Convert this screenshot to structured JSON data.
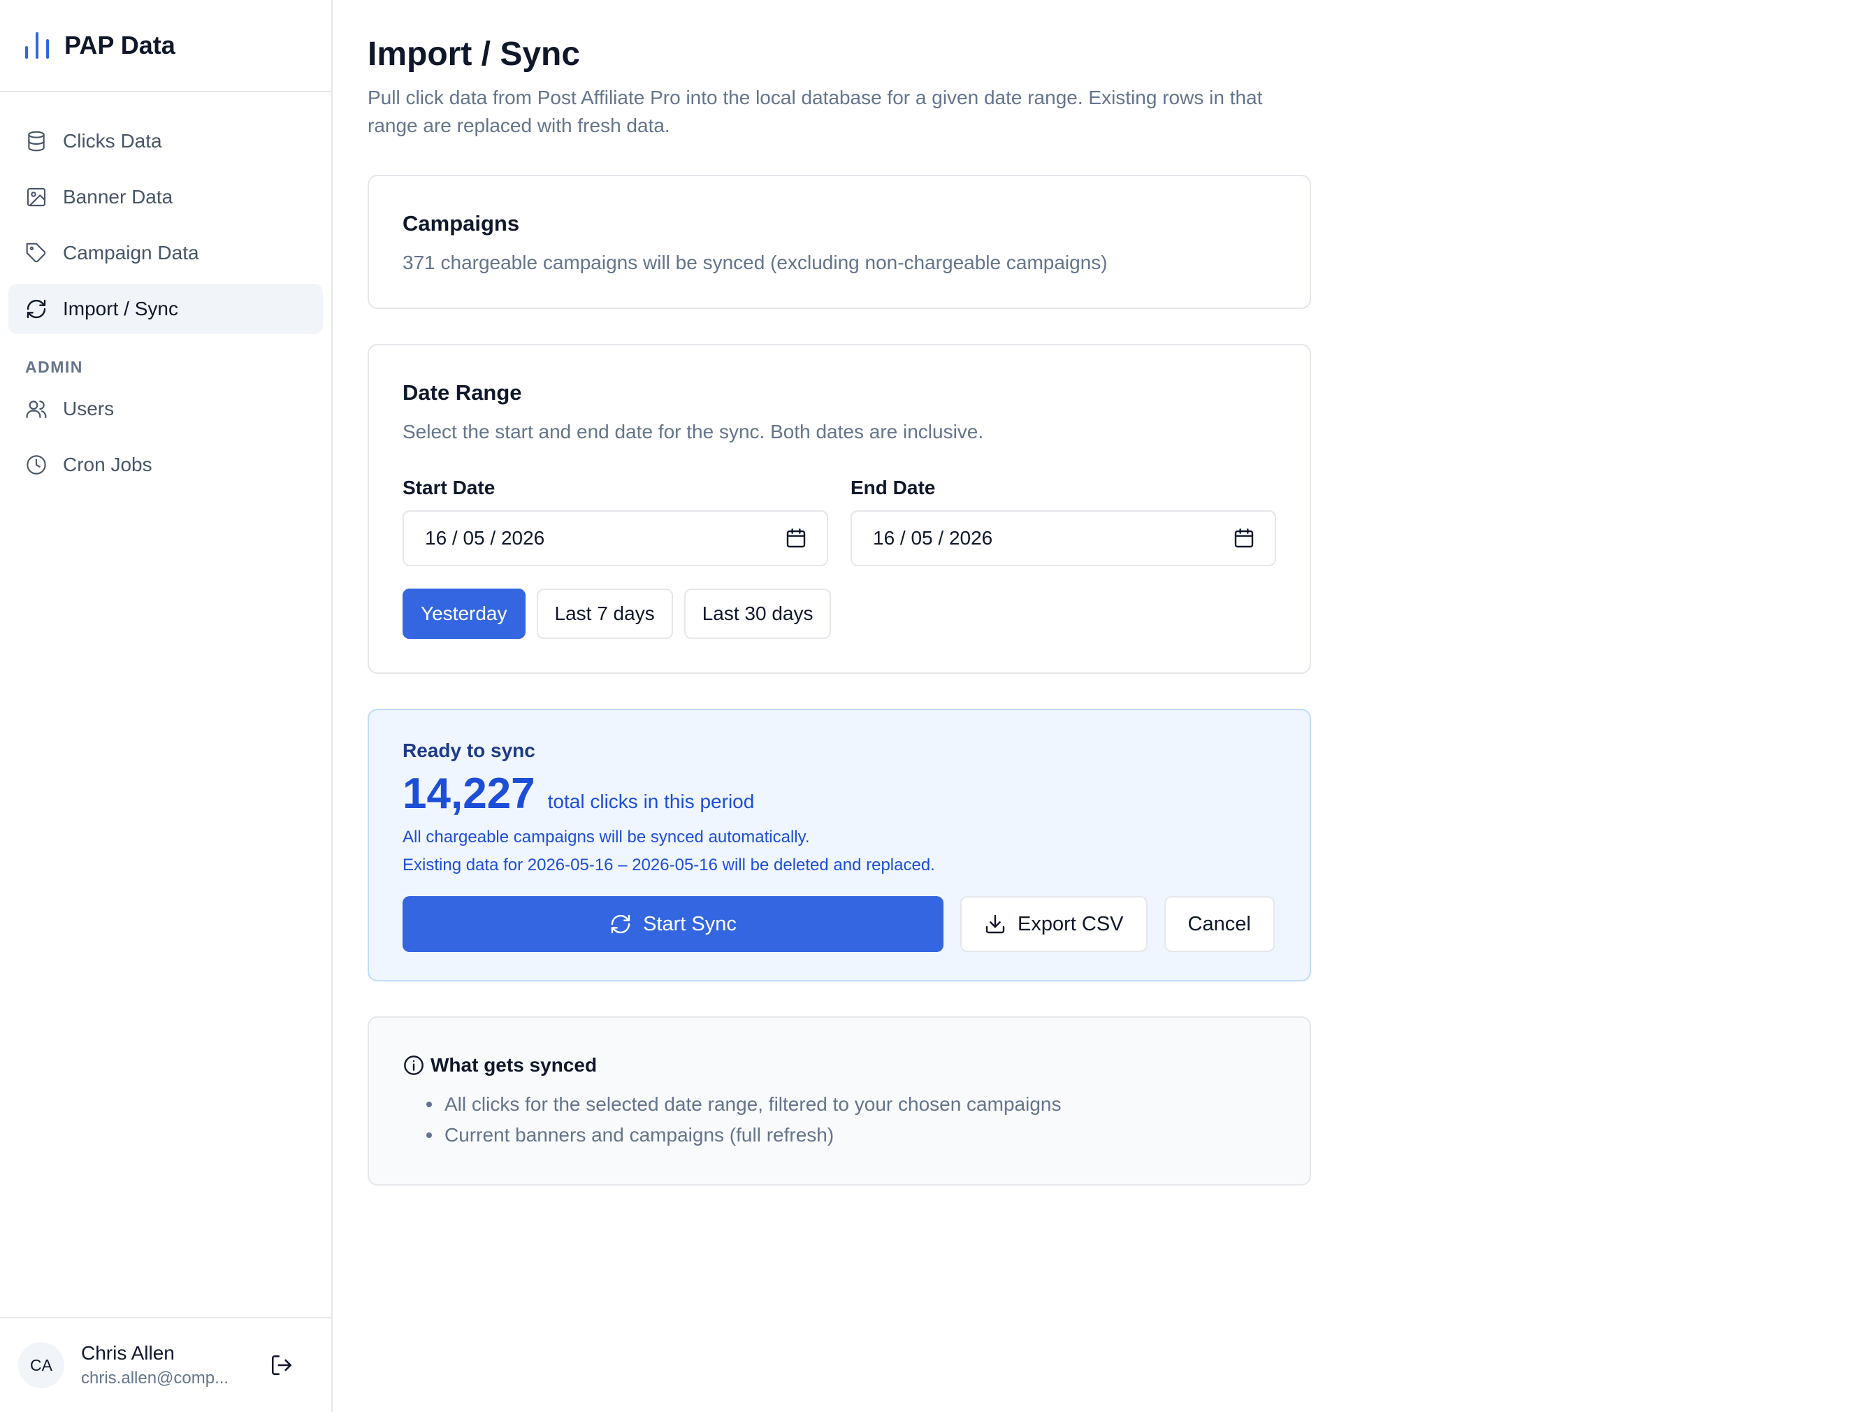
{
  "app": {
    "name": "PAP Data"
  },
  "sidebar": {
    "items": [
      {
        "label": "Clicks Data",
        "icon": "database-icon"
      },
      {
        "label": "Banner Data",
        "icon": "image-icon"
      },
      {
        "label": "Campaign Data",
        "icon": "tag-icon"
      },
      {
        "label": "Import / Sync",
        "icon": "refresh-icon",
        "active": true
      }
    ],
    "admin_section": "ADMIN",
    "admin_items": [
      {
        "label": "Users",
        "icon": "users-icon"
      },
      {
        "label": "Cron Jobs",
        "icon": "clock-icon"
      }
    ],
    "user": {
      "initials": "CA",
      "name": "Chris Allen",
      "email": "chris.allen@comp..."
    }
  },
  "page": {
    "title": "Import / Sync",
    "description": "Pull click data from Post Affiliate Pro into the local database for a given date range. Existing rows in that range are replaced with fresh data."
  },
  "campaigns": {
    "title": "Campaigns",
    "subtitle": "371 chargeable campaigns will be synced (excluding non-chargeable campaigns)"
  },
  "date_range": {
    "title": "Date Range",
    "subtitle": "Select the start and end date for the sync. Both dates are inclusive.",
    "start_label": "Start Date",
    "start_value": "16 / 05 / 2026",
    "end_label": "End Date",
    "end_value": "16 / 05 / 2026",
    "presets": [
      "Yesterday",
      "Last 7 days",
      "Last 30 days"
    ],
    "selected_preset": "Yesterday"
  },
  "sync": {
    "heading": "Ready to sync",
    "count": "14,227",
    "count_label": "total clicks in this period",
    "note1": "All chargeable campaigns will be synced automatically.",
    "note2": "Existing data for 2026-05-16 – 2026-05-16 will be deleted and replaced.",
    "start_label": "Start Sync",
    "export_label": "Export CSV",
    "cancel_label": "Cancel"
  },
  "info": {
    "heading": "What gets synced",
    "items": [
      "All clicks for the selected date range, filtered to your chosen campaigns",
      "Current banners and campaigns (full refresh)"
    ]
  },
  "colors": {
    "accent": "#3366e0",
    "sync_bg": "#eff6ff",
    "sync_text": "#1d4ed8"
  }
}
